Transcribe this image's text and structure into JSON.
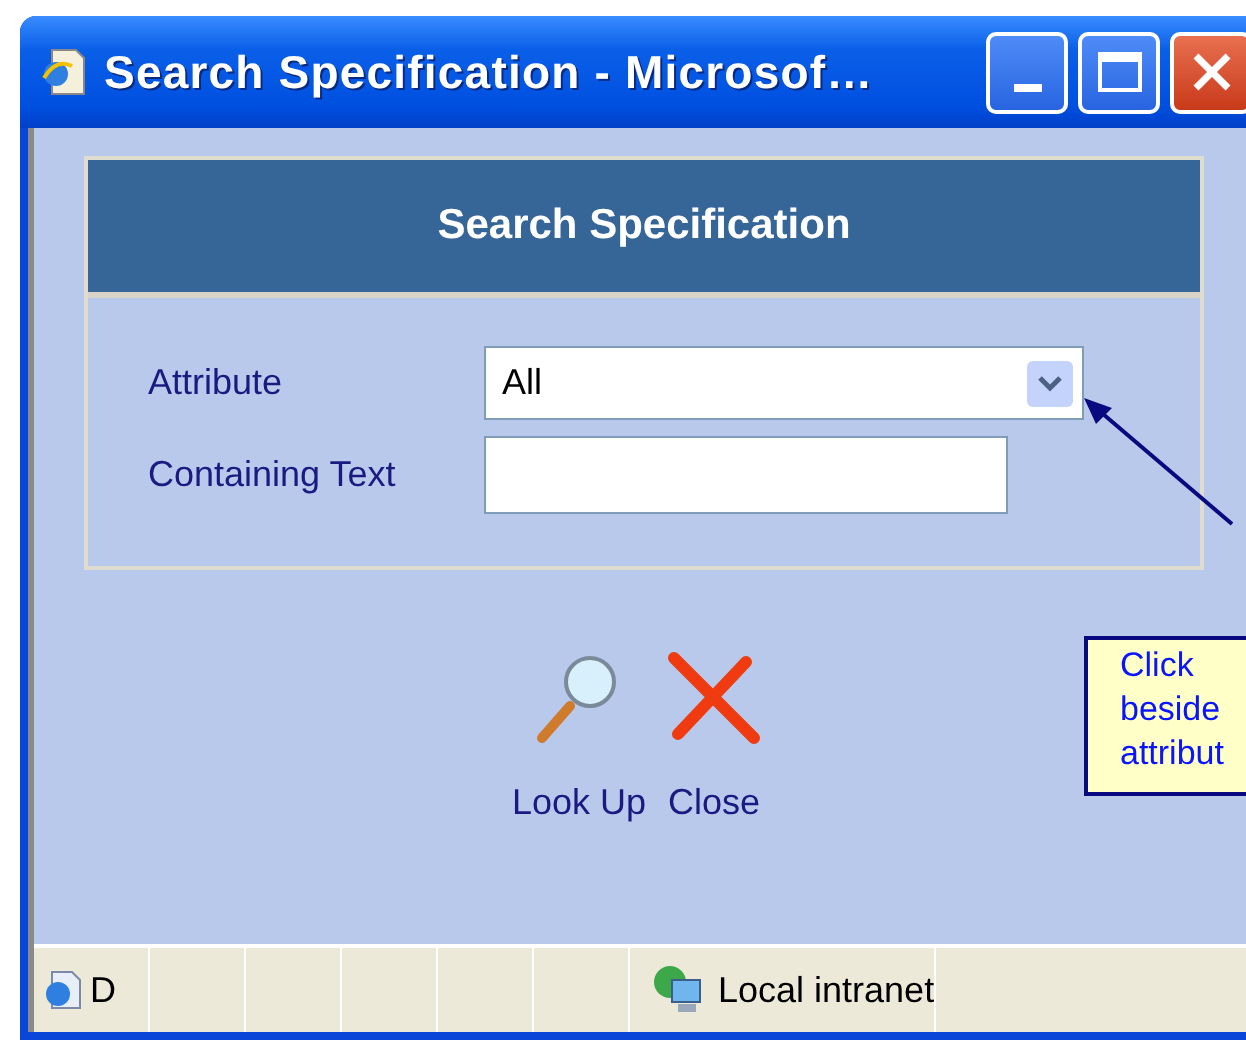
{
  "window": {
    "title": "Search Specification - Microsof…"
  },
  "panel": {
    "heading": "Search Specification",
    "fields": [
      {
        "kind": "select",
        "label": "Attribute",
        "value": "All"
      },
      {
        "kind": "text",
        "label": "Containing Text"
      }
    ]
  },
  "actions": [
    {
      "kind": "search",
      "label": "Look Up"
    },
    {
      "kind": "close",
      "label": "Close"
    }
  ],
  "callout": {
    "text": "Click beside attribut"
  },
  "status_bar": {
    "text": "D",
    "zone": "Local intranet"
  }
}
